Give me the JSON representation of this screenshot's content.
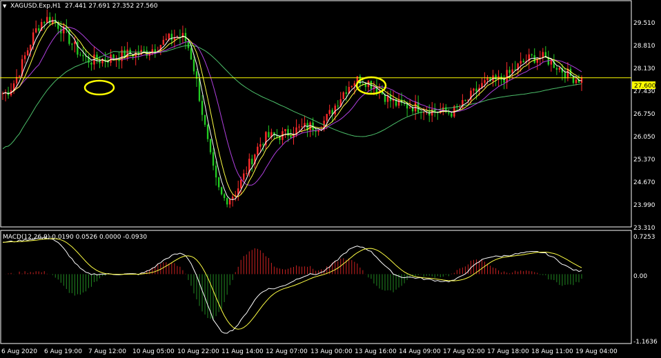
{
  "header": {
    "symbol_label": "XAGUSD.Exp,H1",
    "ohlc_label": "27.441 27.691 27.352 27.560",
    "caret": "▼"
  },
  "macd": {
    "label": "MACD(12,26,9)",
    "values_label": "-0.0190 0.0526 0.0000 -0.0930"
  },
  "price_axis": {
    "ticks": [
      "29.510",
      "28.810",
      "28.130",
      "27.430",
      "26.750",
      "26.050",
      "25.370",
      "24.670",
      "23.990",
      "23.310"
    ],
    "current_price": "27.600"
  },
  "macd_axis": {
    "ticks": [
      "0.7253",
      "0.00",
      "-1.1636"
    ]
  },
  "time_axis": {
    "ticks": [
      "6 Aug 2020",
      "6 Aug 19:00",
      "7 Aug 12:00",
      "10 Aug 05:00",
      "10 Aug 22:00",
      "11 Aug 14:00",
      "12 Aug 07:00",
      "13 Aug 00:00",
      "13 Aug 16:00",
      "14 Aug 09:00",
      "17 Aug 02:00",
      "17 Aug 18:00",
      "18 Aug 11:00",
      "19 Aug 04:00"
    ]
  },
  "colors": {
    "background": "#000000",
    "bull": "#ff2b2b",
    "bear": "#22cc22",
    "ma_fast": "#ffffff",
    "ma_mid": "#ffff44",
    "ma_slow": "#b040e0",
    "ma_long": "#4cbf6a",
    "level_line": "#ffff00",
    "highlight_ellipse": "#ffff00",
    "hist_pos": "#cc2222",
    "hist_neg": "#228822",
    "grid_frame": "#ffffff"
  },
  "chart_data": {
    "type": "candlestick",
    "symbol": "XAGUSD.Exp",
    "timeframe": "H1",
    "ylim": [
      23.31,
      29.81
    ],
    "level_line": 27.6,
    "key_points": {
      "x_times": [
        "6 Aug 2020",
        "6 Aug 19:00",
        "7 Aug 12:00",
        "10 Aug 05:00",
        "10 Aug 22:00",
        "11 Aug 14:00",
        "12 Aug 07:00",
        "13 Aug 00:00",
        "13 Aug 16:00",
        "14 Aug 09:00",
        "17 Aug 02:00",
        "17 Aug 18:00",
        "18 Aug 11:00",
        "19 Aug 04:00"
      ],
      "close_path": [
        27.15,
        29.3,
        28.1,
        28.3,
        28.8,
        24.1,
        25.9,
        26.2,
        27.55,
        26.8,
        26.6,
        27.5,
        28.2,
        27.56
      ]
    },
    "macd_ylim": [
      -1.1636,
      0.7253
    ],
    "macd_path": [
      0.55,
      0.62,
      0.0,
      0.0,
      0.35,
      -1.0,
      -0.25,
      0.0,
      0.47,
      -0.05,
      -0.12,
      0.3,
      0.38,
      0.05
    ]
  }
}
